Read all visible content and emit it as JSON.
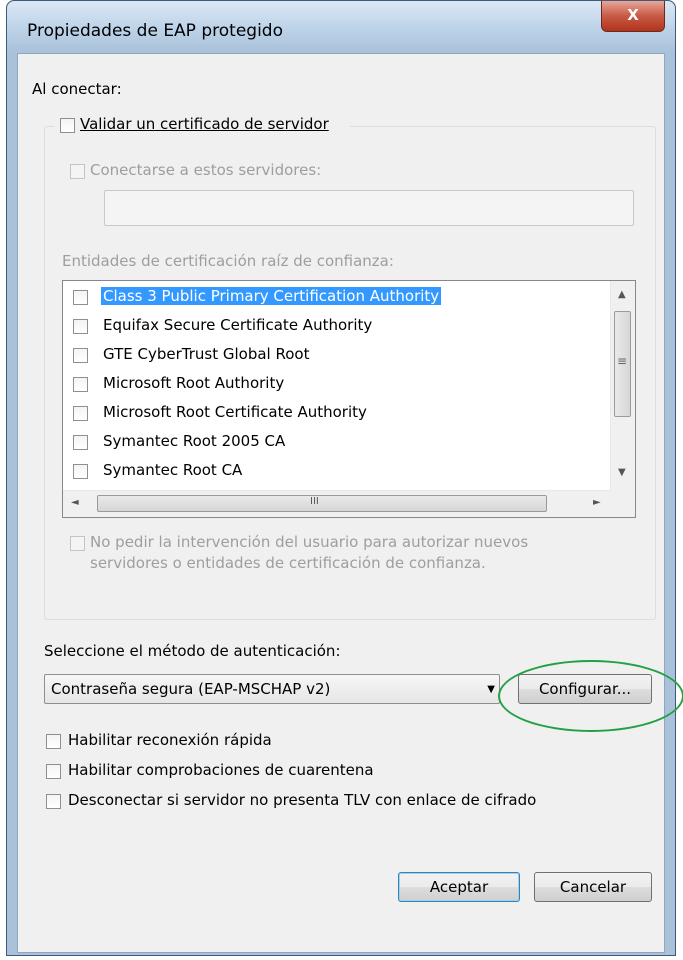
{
  "window": {
    "title": "Propiedades de EAP protegido",
    "close_label": "X"
  },
  "connect_label": "Al conectar:",
  "validate_cert": {
    "label": "Validar un certificado de servidor",
    "checked": false
  },
  "connect_servers": {
    "label": "Conectarse a estos servidores:",
    "checked": false,
    "value": ""
  },
  "trusted_root_label": "Entidades de certificación raíz de confianza:",
  "cert_list": [
    {
      "label": "Class 3 Public Primary Certification Authority",
      "checked": false,
      "selected": true
    },
    {
      "label": "Equifax Secure Certificate Authority",
      "checked": false,
      "selected": false
    },
    {
      "label": "GTE CyberTrust Global Root",
      "checked": false,
      "selected": false
    },
    {
      "label": "Microsoft Root Authority",
      "checked": false,
      "selected": false
    },
    {
      "label": "Microsoft Root Certificate Authority",
      "checked": false,
      "selected": false
    },
    {
      "label": "Symantec Root 2005 CA",
      "checked": false,
      "selected": false
    },
    {
      "label": "Symantec Root CA",
      "checked": false,
      "selected": false
    }
  ],
  "scroll": {
    "up": "▲",
    "down": "▼",
    "left": "◄",
    "right": "►",
    "grip_v": "≡",
    "grip_h": "III"
  },
  "no_prompt": {
    "line1": "No pedir la intervención del usuario para autorizar nuevos",
    "line2": "servidores o entidades de certificación de confianza.",
    "checked": false
  },
  "auth_method_label": "Seleccione el método de autenticación:",
  "auth_method_value": "Contraseña segura (EAP-MSCHAP v2)",
  "dropdown_icon": "▼",
  "configure_button": "Configurar...",
  "options": [
    {
      "label": "Habilitar reconexión rápida",
      "checked": false
    },
    {
      "label": "Habilitar comprobaciones de cuarentena",
      "checked": false
    },
    {
      "label": "Desconectar si servidor no presenta TLV con enlace de cifrado",
      "checked": false
    }
  ],
  "ok_button": "Aceptar",
  "cancel_button": "Cancelar",
  "colors": {
    "selection": "#3399ff",
    "annotation": "#22a045"
  }
}
